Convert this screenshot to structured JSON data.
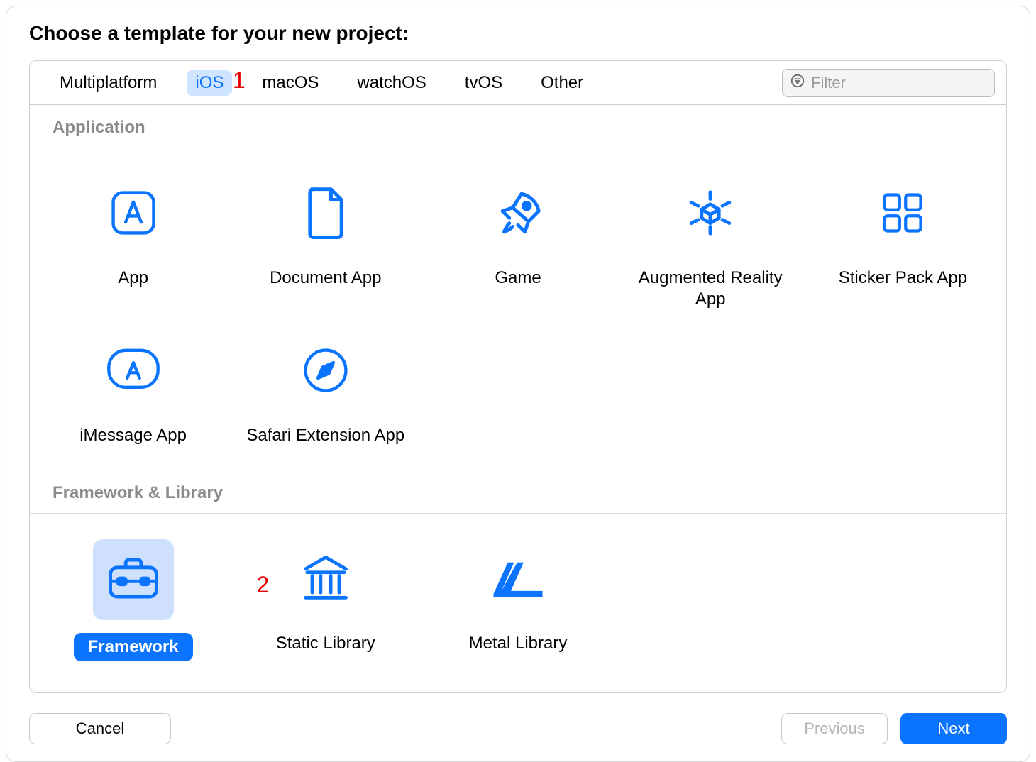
{
  "header": {
    "title": "Choose a template for your new project:"
  },
  "tabs": {
    "multiplatform": "Multiplatform",
    "ios": "iOS",
    "macos": "macOS",
    "watchos": "watchOS",
    "tvos": "tvOS",
    "other": "Other",
    "selected": "ios"
  },
  "filter": {
    "placeholder": "Filter"
  },
  "sections": {
    "application": {
      "title": "Application",
      "items": {
        "app": "App",
        "document_app": "Document App",
        "game": "Game",
        "ar_app": "Augmented Reality App",
        "sticker_app": "Sticker Pack App",
        "imessage_app": "iMessage App",
        "safari_ext": "Safari Extension App"
      }
    },
    "framework": {
      "title": "Framework & Library",
      "items": {
        "framework": "Framework",
        "static_library": "Static Library",
        "metal_library": "Metal Library"
      }
    }
  },
  "annotations": {
    "one": "1",
    "two": "2"
  },
  "footer": {
    "cancel": "Cancel",
    "previous": "Previous",
    "next": "Next"
  },
  "colors": {
    "accent": "#0a74ff",
    "selection_fill": "#cfe0fc",
    "tab_selection_fill": "#cfe4ff",
    "annot": "#e60000"
  }
}
